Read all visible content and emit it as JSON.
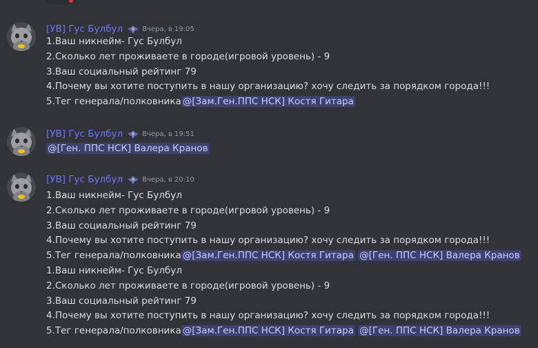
{
  "messages": [
    {
      "author": "[УВ] Гус Булбул",
      "timestamp": "Вчера, в 19:05",
      "lines": [
        {
          "text": "1.Ваш никнейм- Гус Булбул"
        },
        {
          "text": "2.Сколько лет проживаете в городе(игровой уровень) - 9"
        },
        {
          "text": "3.Ваш социальный рейтинг 79"
        },
        {
          "text": "4.Почему вы хотите поступить в нашу организацию? хочу следить за порядком города!!!"
        },
        {
          "text": "5.Тег генерала/полковника",
          "mentions": [
            "@[Зам.Ген.ППС НСК] Костя Гитара"
          ]
        }
      ]
    },
    {
      "author": "[УВ] Гус Булбул",
      "timestamp": "Вчера, в 19:51",
      "lines": [
        {
          "text": "",
          "mentions": [
            "@[Ген. ППС НСК]  Валера Кранов"
          ]
        }
      ]
    },
    {
      "author": "[УВ] Гус Булбул",
      "timestamp": "Вчера, в 20:10",
      "lines": [
        {
          "text": "1.Ваш никнейм- Гус Булбул"
        },
        {
          "text": "2.Сколько лет проживаете в городе(игровой уровень) - 9"
        },
        {
          "text": "3.Ваш социальный рейтинг 79"
        },
        {
          "text": "4.Почему вы хотите поступить в нашу организацию? хочу следить за порядком города!!!"
        },
        {
          "text": "5.Тег генерала/полковника",
          "mentions": [
            "@[Зам.Ген.ППС НСК] Костя Гитара",
            "@[Ген. ППС НСК]  Валера Кранов"
          ]
        },
        {
          "text": "1.Ваш никнейм- Гус Булбул"
        },
        {
          "text": "2.Сколько лет проживаете в городе(игровой уровень) - 9"
        },
        {
          "text": "3.Ваш социальный рейтинг 79"
        },
        {
          "text": "4.Почему вы хотите поступить в нашу организацию? хочу следить за порядком города!!!"
        },
        {
          "text": "5.Тег генерала/полковника",
          "mentions": [
            "@[Зам.Ген.ППС НСК] Костя Гитара",
            "@[Ген. ППС НСК]  Валера Кранов"
          ]
        }
      ]
    }
  ],
  "icons": {
    "badge": "police-emblem-icon",
    "avatar": "cat-avatar"
  },
  "colors": {
    "background": "#313338",
    "username": "#6c78ff",
    "mention_bg": "#3c4270",
    "mention_text": "#c9cdfb",
    "timestamp": "#949ba4"
  }
}
